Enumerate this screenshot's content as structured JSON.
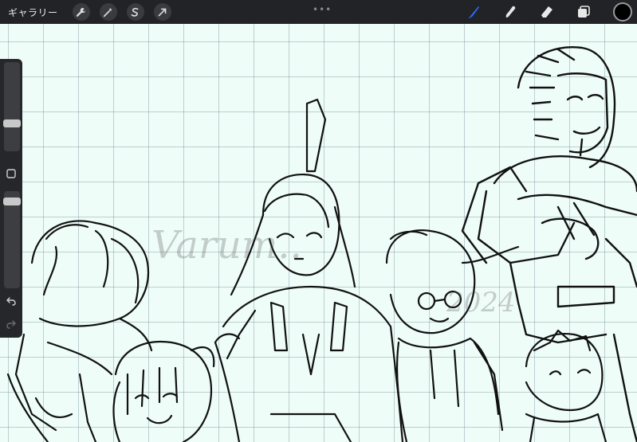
{
  "toolbar": {
    "gallery_label": "ギャラリー",
    "actions_icon": "wrench-icon",
    "adjustments_icon": "magic-wand-icon",
    "selection_icon": "selection-s-icon",
    "transform_icon": "arrow-cursor-icon",
    "more_label": "•••"
  },
  "tools": {
    "brush_icon": "brush-icon",
    "smudge_icon": "smudge-icon",
    "eraser_icon": "eraser-icon",
    "layers_icon": "layers-icon",
    "current_color": "#000000",
    "active_color": "#2e6dff"
  },
  "sidebar": {
    "brush_size_level": 0.7,
    "opacity_level": 0.95,
    "modify_icon": "square-icon",
    "undo_icon": "undo-icon",
    "redo_icon": "redo-icon"
  },
  "watermark": {
    "line1": "Varum..",
    "line2": "2024"
  }
}
